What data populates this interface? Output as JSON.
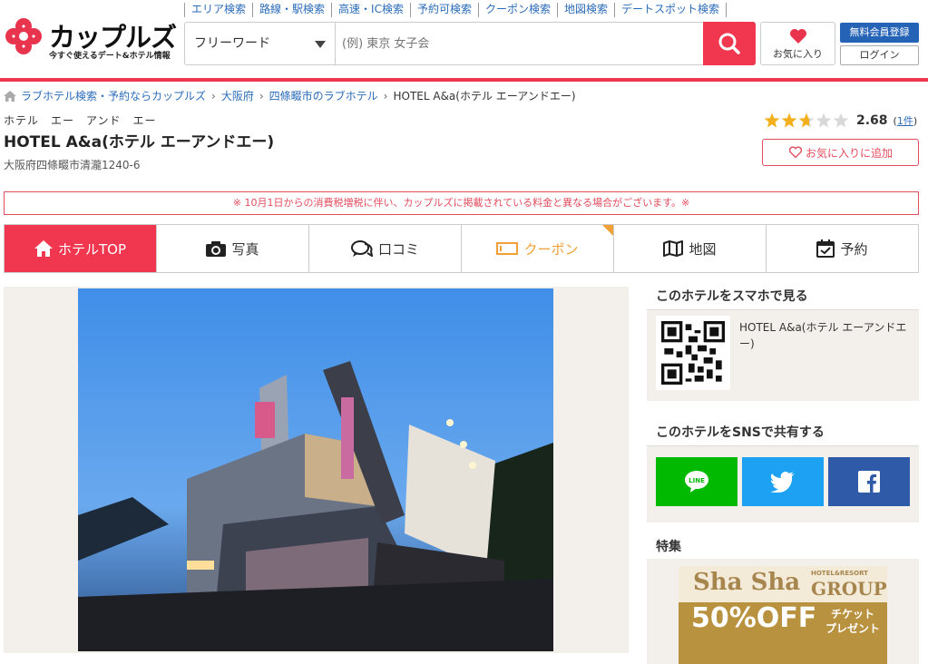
{
  "header": {
    "logo_text": "カップルズ",
    "logo_tagline": "今すぐ使えるデート&ホテル情報",
    "top_links": [
      "エリア検索",
      "路線・駅検索",
      "高速・IC検索",
      "予約可検索",
      "クーポン検索",
      "地図検索",
      "デートスポット検索"
    ],
    "search": {
      "select_value": "フリーワード",
      "placeholder": "(例) 東京 女子会"
    },
    "favorites_label": "お気に入り",
    "register_label": "無料会員登録",
    "login_label": "ログイン"
  },
  "breadcrumb": [
    "ラブホテル検索・予約ならカップルズ",
    "大阪府",
    "四條畷市のラブホテル",
    "HOTEL A&a(ホテル エーアンドエー)"
  ],
  "hotel": {
    "kana": "ホテル　エー　アンド　エー",
    "name": "HOTEL A&a(ホテル エーアンドエー)",
    "address": "大阪府四條畷市清瀧1240-6",
    "rating": "2.68",
    "rating_value": 2.68,
    "review_count": "1件",
    "add_favorite_label": "お気に入りに追加"
  },
  "notice": "※ 10月1日からの消費税増税に伴い、カップルズに掲載されている料金と異なる場合がございます。※",
  "tabs": [
    {
      "label": "ホテルTOP",
      "icon": "home-icon",
      "active": true
    },
    {
      "label": "写真",
      "icon": "camera-icon"
    },
    {
      "label": "口コミ",
      "icon": "comment-icon"
    },
    {
      "label": "クーポン",
      "icon": "coupon-icon"
    },
    {
      "label": "地図",
      "icon": "map-icon"
    },
    {
      "label": "予約",
      "icon": "calendar-icon"
    }
  ],
  "sidebar": {
    "mobile_title": "このホテルをスマホで見る",
    "mobile_hotel": "HOTEL A&a(ホテル エーアンドエー)",
    "sns_title": "このホテルをSNSで共有する",
    "sns_line": "LINE",
    "feature_title": "特集",
    "banner_line1": "Sha Sha",
    "banner_small": "HOTEL&RESORT",
    "banner_group": "GROUP",
    "banner_offer": "50%OFF",
    "banner_ticket": "チケット",
    "banner_present": "プレゼント"
  },
  "colors": {
    "brand": "#f0374f",
    "link": "#2b6cb8",
    "line": "#00b900",
    "twitter": "#1da1f2",
    "facebook": "#3b5998",
    "coupon": "#f0a037"
  }
}
